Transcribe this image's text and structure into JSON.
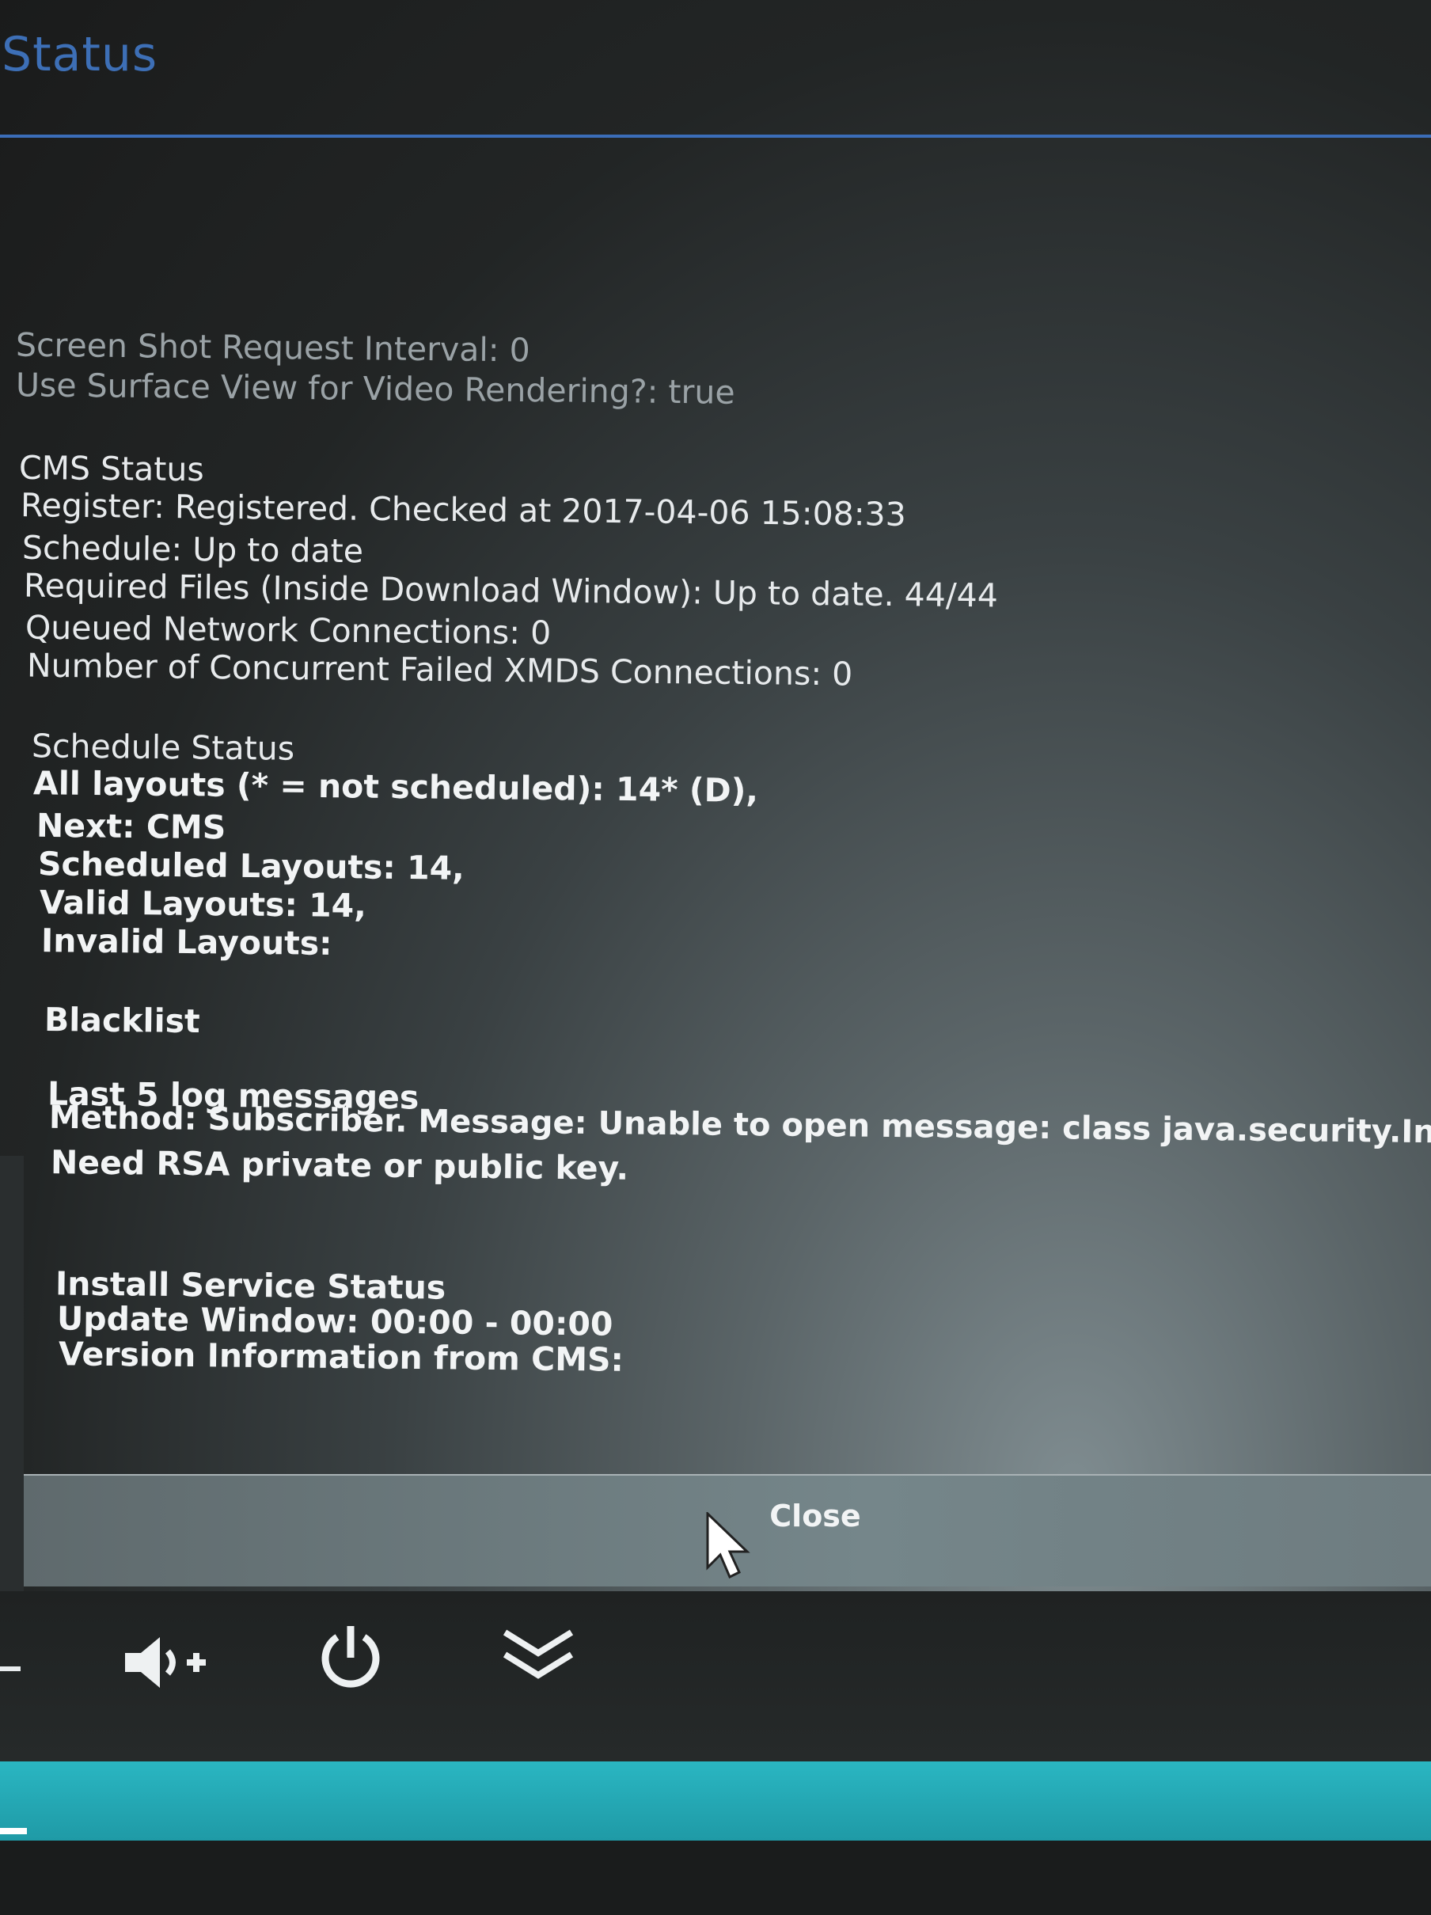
{
  "dialog": {
    "title": "Status",
    "lines": [
      "Screen Shot Request Interval: 0",
      "Use Surface View for Video Rendering?: true",
      "CMS Status",
      "Register: Registered. Checked at 2017-04-06 15:08:33",
      "Schedule: Up to date",
      "Required Files (Inside Download Window): Up to date. 44/44",
      "Queued Network Connections: 0",
      "Number of Concurrent Failed XMDS Connections: 0",
      "Schedule Status",
      "All layouts (* = not scheduled): 14* (D),",
      "Next: CMS",
      "Scheduled Layouts: 14,",
      "Valid Layouts: 14,",
      "Invalid Layouts:",
      "Blacklist",
      "Last 5 log messages",
      "Method: Subscriber. Message: Unable to open message: class java.security.InvalidKeyExceptio",
      "Need RSA private or public key.",
      "Install Service Status",
      "Update Window: 00:00 - 00:00",
      "Version Information from CMS:"
    ],
    "close_label": "Close"
  },
  "nav_bar": {
    "icons": [
      "volume-up-icon",
      "power-icon",
      "chevron-double-down-icon"
    ]
  },
  "colors": {
    "title": "#3d6fb6",
    "divider": "#3b6db8",
    "text": "#e7eaec",
    "nav_bar": "#222525",
    "teal_bar": "#24a8b4"
  }
}
